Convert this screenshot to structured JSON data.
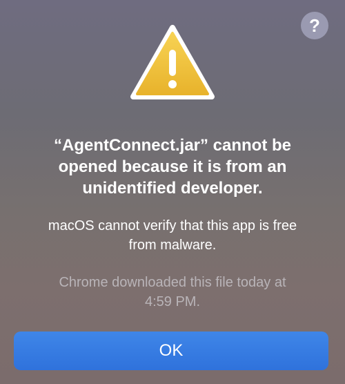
{
  "dialog": {
    "help_label": "?",
    "icon": "warning-triangle-icon",
    "title_line1": "“AgentConnect.jar” cannot be",
    "title_line2": "opened because it is from an",
    "title_line3": "unidentified developer.",
    "message_line1": "macOS cannot verify that this app is free",
    "message_line2": "from malware.",
    "info_line1": "Chrome downloaded this file today at",
    "info_line2": "4:59 PM.",
    "ok_label": "OK"
  },
  "colors": {
    "accent": "#2f72dc",
    "warning_yellow": "#f2c13a",
    "help_button": "#9a9ab1"
  }
}
